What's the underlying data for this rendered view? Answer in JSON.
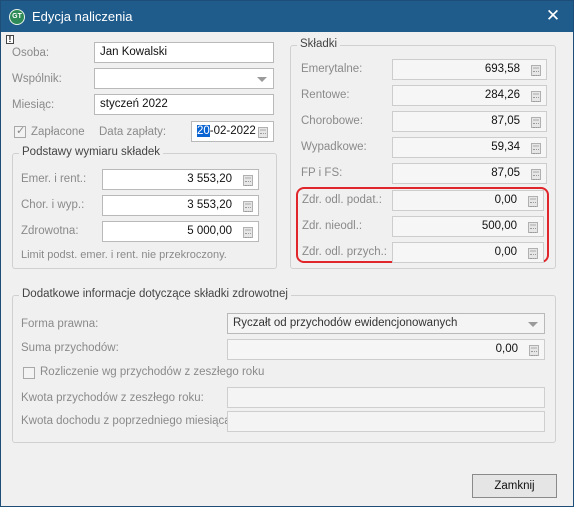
{
  "window": {
    "title": "Edycja naliczenia",
    "close_glyph": "✕",
    "icon": "app-logo-icon",
    "icon_text": "GT",
    "warn_glyph": "!"
  },
  "left": {
    "osoba_label": "Osoba:",
    "osoba_value": "Jan Kowalski",
    "wspolnik_label": "Wspólnik:",
    "wspolnik_value": "",
    "miesiac_label": "Miesiąc:",
    "miesiac_value": "styczeń 2022",
    "zaplacone_label": "Zapłacone",
    "zaplacone_checked": true,
    "data_zaplaty_label": "Data zapłaty:",
    "data_zaplaty_selected": "20",
    "data_zaplaty_rest": "-02-2022"
  },
  "podstawy": {
    "legend": "Podstawy wymiaru składek",
    "emer_label": "Emer. i rent.:",
    "emer_value": "3 553,20",
    "chor_label": "Chor. i wyp.:",
    "chor_value": "3 553,20",
    "zdrowotna_label": "Zdrowotna:",
    "zdrowotna_value": "5 000,00",
    "limit_note": "Limit podst. emer. i rent. nie przekroczony."
  },
  "skladki": {
    "legend": "Składki",
    "items": [
      {
        "label": "Emerytalne:",
        "value": "693,58"
      },
      {
        "label": "Rentowe:",
        "value": "284,26"
      },
      {
        "label": "Chorobowe:",
        "value": "87,05"
      },
      {
        "label": "Wypadkowe:",
        "value": "59,34"
      },
      {
        "label": "FP i FS:",
        "value": "87,05"
      },
      {
        "label": "Zdr. odl. podat.:",
        "value": "0,00"
      },
      {
        "label": "Zdr. nieodl.:",
        "value": "500,00"
      },
      {
        "label": "Zdr. odl. przych.:",
        "value": "0,00"
      }
    ]
  },
  "dodatkowe": {
    "legend": "Dodatkowe informacje dotyczące składki zdrowotnej",
    "forma_label": "Forma prawna:",
    "forma_value": "Ryczałt od przychodów ewidencjonowanych",
    "suma_label": "Suma przychodów:",
    "suma_value": "0,00",
    "rozliczenie_label": "Rozliczenie wg przychodów z zeszłego roku",
    "rozliczenie_checked": false,
    "kwota_przych_label": "Kwota przychodów z zeszłego roku:",
    "kwota_przych_value": "",
    "kwota_doch_label": "Kwota dochodu z poprzedniego miesiąca:",
    "kwota_doch_value": ""
  },
  "footer": {
    "close_button": "Zamknij"
  },
  "colors": {
    "titlebar": "#1f5c8c",
    "highlight": "#e0262b",
    "selection": "#0a64d2"
  }
}
